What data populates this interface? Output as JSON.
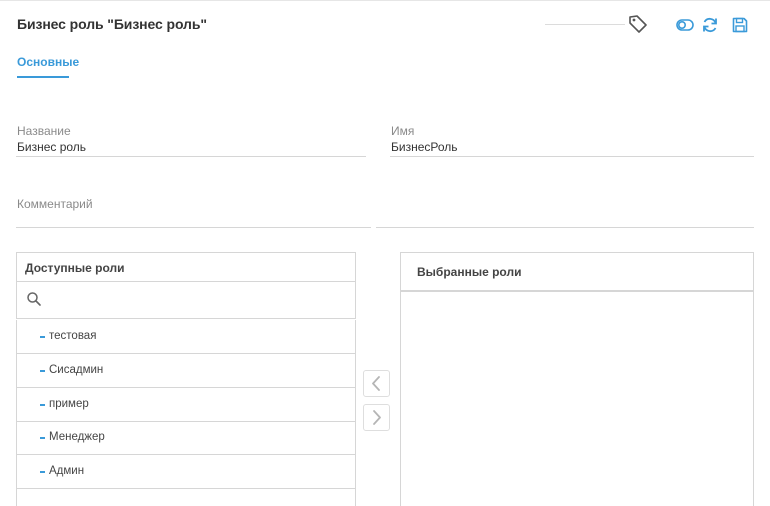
{
  "header": {
    "title": "Бизнес роль \"Бизнес роль\"",
    "tag_icon": "tag-icon",
    "toggle_icon": "toggle-icon",
    "refresh_icon": "refresh-icon",
    "save_icon": "save-icon",
    "accent_color": "#3a9ad9"
  },
  "tabs": [
    {
      "label": "Основные",
      "active": true
    }
  ],
  "form": {
    "name_label": "Название",
    "name_value": "Бизнес роль",
    "id_label": "Имя",
    "id_value": "БизнесРоль",
    "comment_label": "Комментарий",
    "comment_value": ""
  },
  "available_roles": {
    "title": "Доступные роли",
    "search_placeholder": "",
    "items": [
      {
        "label": "тестовая"
      },
      {
        "label": "Сисадмин"
      },
      {
        "label": "пример"
      },
      {
        "label": "Менеджер"
      },
      {
        "label": "Админ"
      }
    ]
  },
  "selected_roles": {
    "title": "Выбранные роли",
    "items": []
  },
  "transfer": {
    "left_icon": "chevron-left-icon",
    "right_icon": "chevron-right-icon"
  }
}
